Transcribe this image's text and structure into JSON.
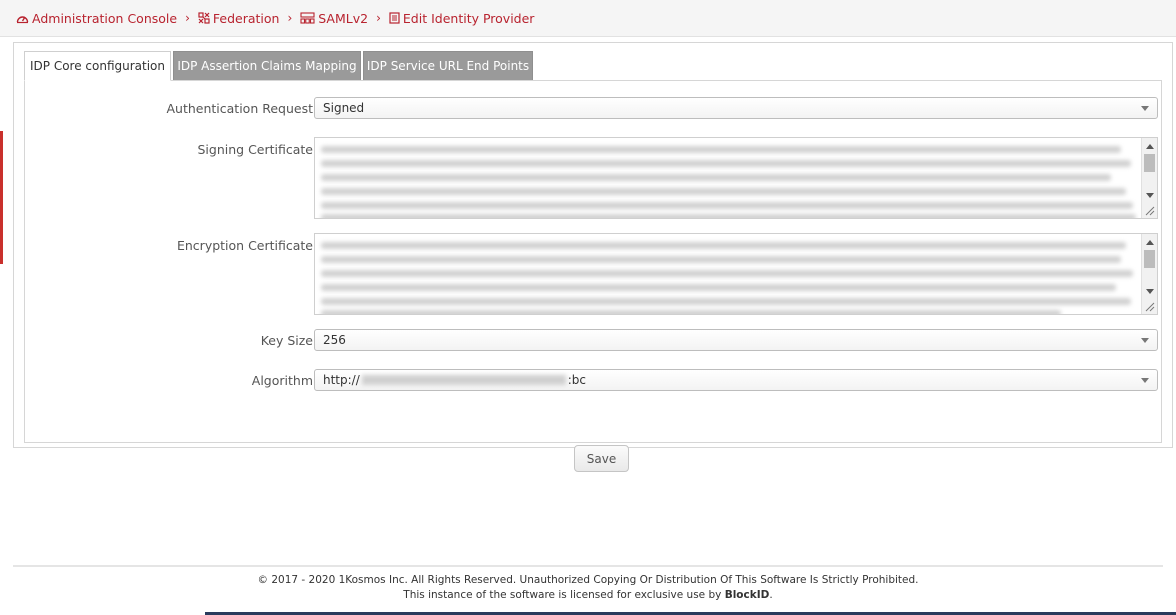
{
  "breadcrumb": {
    "items": [
      {
        "label": "Administration Console",
        "icon": "dashboard-icon"
      },
      {
        "label": "Federation",
        "icon": "federation-icon"
      },
      {
        "label": "SAMLv2",
        "icon": "saml-icon"
      },
      {
        "label": "Edit Identity Provider",
        "icon": "edit-doc-icon"
      }
    ],
    "separator": "›"
  },
  "tabs": [
    {
      "label": "IDP Core configuration",
      "active": true
    },
    {
      "label": "IDP Assertion Claims Mapping",
      "active": false
    },
    {
      "label": "IDP Service URL End Points",
      "active": false
    }
  ],
  "form": {
    "auth_request": {
      "label": "Authentication Request",
      "value": "Signed"
    },
    "signing_cert": {
      "label": "Signing Certificate"
    },
    "encryption_cert": {
      "label": "Encryption Certificate"
    },
    "key_size": {
      "label": "Key Size",
      "value": "256"
    },
    "algorithm": {
      "label": "Algorithm",
      "value_prefix": "http://",
      "value_suffix": ":bc"
    },
    "save_label": "Save"
  },
  "footer": {
    "line1": "© 2017 - 2020  1Kosmos Inc. All Rights Reserved. Unauthorized Copying Or Distribution Of This Software Is Strictly Prohibited.",
    "line2_prefix": "This instance of the software is licensed for exclusive use by ",
    "line2_bold": "BlockID",
    "line2_suffix": "."
  },
  "colors": {
    "accent": "#b8232f",
    "tab_inactive": "#9a9a9a",
    "indicator": "#c9302c"
  }
}
